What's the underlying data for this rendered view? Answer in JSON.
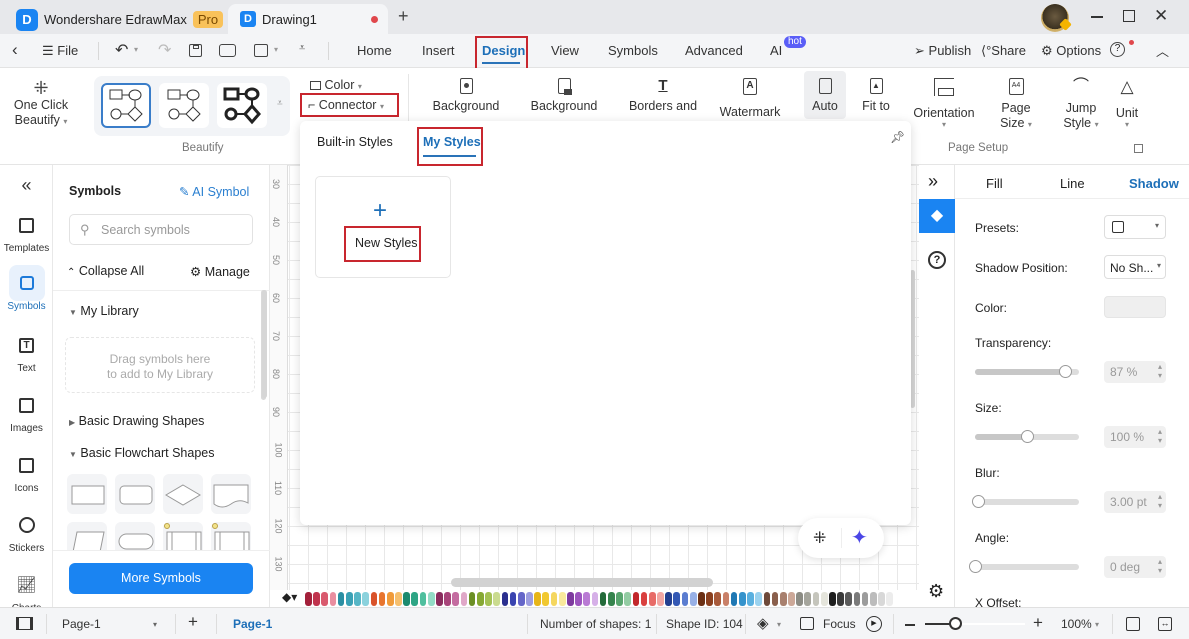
{
  "titlebar": {
    "app_name": "Wondershare EdrawMax",
    "pro_badge": "Pro",
    "doc_tab": "Drawing1",
    "new_tab": "+"
  },
  "menubar": {
    "file": "File",
    "tabs": [
      "Home",
      "Insert",
      "Design",
      "View",
      "Symbols",
      "Advanced",
      "AI"
    ],
    "active_tab": "Design",
    "ai_badge": "hot",
    "publish": "Publish",
    "share": "Share",
    "options": "Options"
  },
  "ribbon": {
    "one_click": "One Click",
    "beautify": "Beautify",
    "beautify_group": "Beautify",
    "color": "Color",
    "connector": "Connector",
    "background1": "Background",
    "background2": "Background",
    "borders": "Borders and",
    "watermark": "Watermark",
    "auto": "Auto",
    "fit_to": "Fit to",
    "orientation": "Orientation",
    "page": "Page",
    "size": "Size",
    "jump": "Jump",
    "style": "Style",
    "unit": "Unit",
    "page_setup_group": "Page Setup"
  },
  "dropdown": {
    "tabs": [
      "Built-in Styles",
      "My Styles"
    ],
    "active_tab": "My Styles",
    "new_styles": "New Styles"
  },
  "leftnav": {
    "items": [
      "Templates",
      "Symbols",
      "Text",
      "Images",
      "Icons",
      "Stickers",
      "Charts"
    ],
    "active": "Symbols"
  },
  "symbols": {
    "title": "Symbols",
    "ai_symbol": "AI Symbol",
    "search_placeholder": "Search symbols",
    "collapse_all": "Collapse All",
    "manage": "Manage",
    "my_library": "My Library",
    "library_hint_1": "Drag symbols here",
    "library_hint_2": "to add to My Library",
    "basic_drawing": "Basic Drawing Shapes",
    "basic_flowchart": "Basic Flowchart Shapes",
    "more_symbols": "More Symbols"
  },
  "ruler": {
    "ticks": [
      "30",
      "40",
      "50",
      "60",
      "70",
      "80",
      "90",
      "100",
      "110",
      "120",
      "130"
    ]
  },
  "props": {
    "tabs": [
      "Fill",
      "Line",
      "Shadow"
    ],
    "active_tab": "Shadow",
    "presets_label": "Presets:",
    "shadow_position_label": "Shadow Position:",
    "shadow_position_value": "No Sh...",
    "color_label": "Color:",
    "transparency_label": "Transparency:",
    "transparency_value": "87 %",
    "transparency_fraction": 0.87,
    "size_label": "Size:",
    "size_value": "100 %",
    "size_fraction": 0.5,
    "blur_label": "Blur:",
    "blur_value": "3.00 pt",
    "blur_fraction": 0.03,
    "angle_label": "Angle:",
    "angle_value": "0 deg",
    "angle_fraction": 0.0,
    "x_offset_label": "X Offset:"
  },
  "palette": {
    "colors": [
      "#a3203a",
      "#c0334d",
      "#d95a6e",
      "#e98ea0",
      "#2a8fa3",
      "#3aa1b5",
      "#56b6c6",
      "#8bd2dd",
      "#d9532b",
      "#e8752e",
      "#f09b3a",
      "#f6bf6d",
      "#1c8a6e",
      "#2ea585",
      "#4fbf9e",
      "#93dcc6",
      "#8a2d5e",
      "#a8447a",
      "#c46ca0",
      "#e0a8c8",
      "#6b8f24",
      "#86a833",
      "#a4c154",
      "#cadb8f",
      "#2b2f8f",
      "#3a44b0",
      "#6566c9",
      "#9d9de0",
      "#e7b519",
      "#f1c830",
      "#f5d75f",
      "#f9e99c",
      "#7d3a9e",
      "#9c54be",
      "#b97ad4",
      "#d6b0e8",
      "#246b3a",
      "#35844d",
      "#58a56e",
      "#93cca3",
      "#c2282b",
      "#d9403f",
      "#e86c68",
      "#f2a7a3",
      "#233f8f",
      "#3358b4",
      "#5b7dd0",
      "#98b0e6",
      "#6b2f14",
      "#8a3f1e",
      "#a85a3a",
      "#c98068",
      "#1f78b4",
      "#3593cc",
      "#5ab0df",
      "#9ad2ef",
      "#6e4a3a",
      "#8a5f4c",
      "#a8806e",
      "#cca898",
      "#8c8c84",
      "#a5a59c",
      "#c5c5bc",
      "#e5e5dc",
      "#1e1e1e",
      "#3a3a3a",
      "#5a5a5a",
      "#7a7a7a",
      "#9c9c9c",
      "#bcbcbc",
      "#d8d8d8",
      "#ececec"
    ]
  },
  "status": {
    "page_selector": "Page-1",
    "active_page": "Page-1",
    "shape_count": "Number of shapes: 1",
    "shape_id": "Shape ID: 104",
    "focus": "Focus",
    "zoom": "100%",
    "zoom_fraction": 0.3
  }
}
